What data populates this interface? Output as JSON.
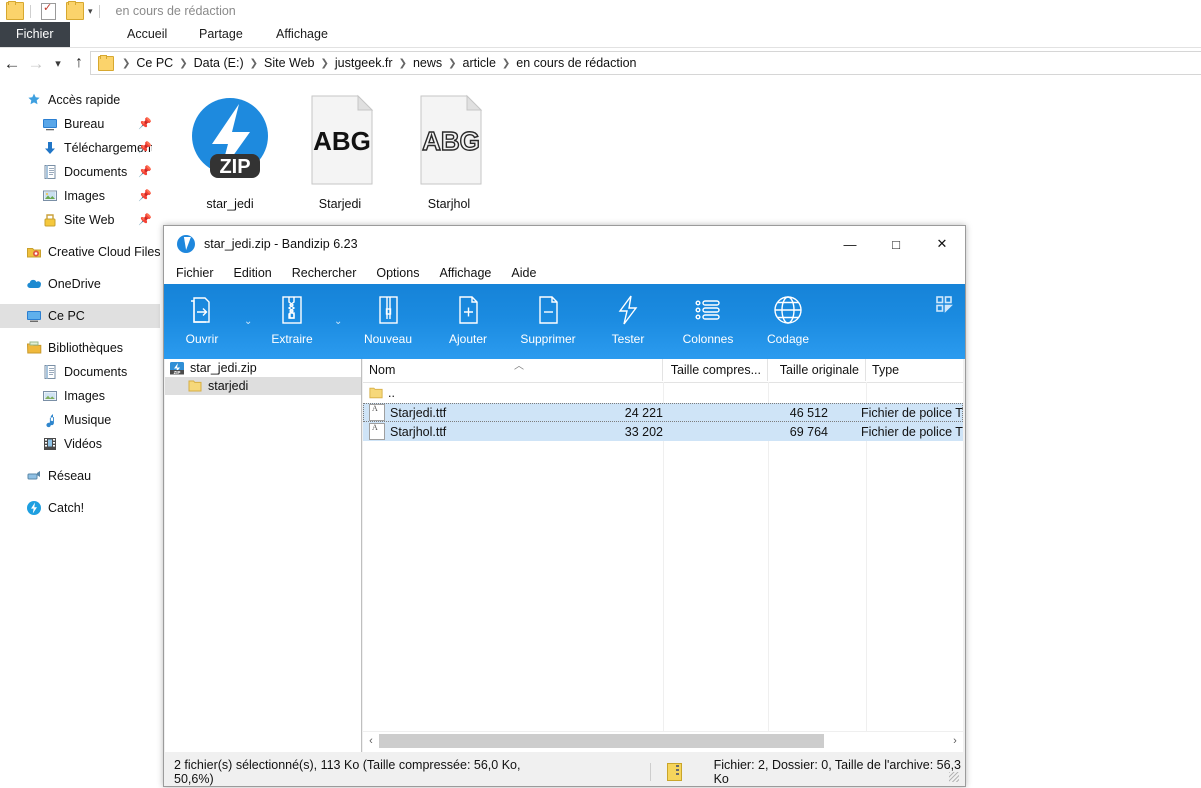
{
  "explorer": {
    "quick_access_toolbar": {
      "title": "en cours de rédaction",
      "icons": [
        "folder-icon",
        "properties-icon",
        "new-folder-icon",
        "customize-caret-icon"
      ]
    },
    "ribbon_tabs": [
      {
        "label": "Fichier",
        "active": true
      },
      {
        "label": "Accueil",
        "active": false
      },
      {
        "label": "Partage",
        "active": false
      },
      {
        "label": "Affichage",
        "active": false
      }
    ],
    "navigation": {
      "back_icon": "back-arrow-icon",
      "forward_icon": "forward-arrow-icon",
      "recent_icon": "chevron-down-icon",
      "up_icon": "up-arrow-icon"
    },
    "breadcrumb": [
      "Ce PC",
      "Data (E:)",
      "Site Web",
      "justgeek.fr",
      "news",
      "article",
      "en cours de rédaction"
    ],
    "sidebar": [
      {
        "label": "Accès rapide",
        "icon": "star-icon",
        "indent": 0,
        "pinned": false,
        "selected": false
      },
      {
        "label": "Bureau",
        "icon": "desktop-icon",
        "indent": 1,
        "pinned": true,
        "selected": false
      },
      {
        "label": "Téléchargements",
        "icon": "download-icon",
        "indent": 1,
        "pinned": true,
        "selected": false
      },
      {
        "label": "Documents",
        "icon": "documents-icon",
        "indent": 1,
        "pinned": true,
        "selected": false
      },
      {
        "label": "Images",
        "icon": "pictures-icon",
        "indent": 1,
        "pinned": true,
        "selected": false
      },
      {
        "label": "Site Web",
        "icon": "lock-folder-icon",
        "indent": 1,
        "pinned": true,
        "selected": false
      },
      {
        "label": "Creative Cloud Files",
        "icon": "creative-cloud-icon",
        "indent": 0,
        "pinned": false,
        "selected": false
      },
      {
        "label": "OneDrive",
        "icon": "cloud-icon",
        "indent": 0,
        "pinned": false,
        "selected": false
      },
      {
        "label": "Ce PC",
        "icon": "this-pc-icon",
        "indent": 0,
        "pinned": false,
        "selected": true
      },
      {
        "label": "Bibliothèques",
        "icon": "libraries-icon",
        "indent": 0,
        "pinned": false,
        "selected": false
      },
      {
        "label": "Documents",
        "icon": "documents-icon",
        "indent": 1,
        "pinned": false,
        "selected": false
      },
      {
        "label": "Images",
        "icon": "pictures-icon",
        "indent": 1,
        "pinned": false,
        "selected": false
      },
      {
        "label": "Musique",
        "icon": "music-icon",
        "indent": 1,
        "pinned": false,
        "selected": false
      },
      {
        "label": "Vidéos",
        "icon": "video-icon",
        "indent": 1,
        "pinned": false,
        "selected": false
      },
      {
        "label": "Réseau",
        "icon": "network-icon",
        "indent": 0,
        "pinned": false,
        "selected": false
      },
      {
        "label": "Catch!",
        "icon": "catch-icon",
        "indent": 0,
        "pinned": false,
        "selected": false
      }
    ],
    "files": [
      {
        "name": "star_jedi",
        "icon": "zip-archive-icon",
        "badge": "ZIP"
      },
      {
        "name": "Starjedi",
        "icon": "font-file-icon",
        "badge": "ABG"
      },
      {
        "name": "Starjhol",
        "icon": "font-file-outline-icon",
        "badge": "ABG"
      }
    ]
  },
  "bandizip": {
    "title": "star_jedi.zip - Bandizip 6.23",
    "window_controls": {
      "minimize": "—",
      "maximize": "□",
      "close": "✕"
    },
    "menus": [
      "Fichier",
      "Edition",
      "Rechercher",
      "Options",
      "Affichage",
      "Aide"
    ],
    "toolbar": [
      {
        "label": "Ouvrir",
        "icon": "open-archive-icon",
        "has_caret": true
      },
      {
        "label": "Extraire",
        "icon": "extract-icon",
        "has_caret": true
      },
      {
        "label": "Nouveau",
        "icon": "new-archive-icon",
        "has_caret": false
      },
      {
        "label": "Ajouter",
        "icon": "add-file-icon",
        "has_caret": false
      },
      {
        "label": "Supprimer",
        "icon": "delete-file-icon",
        "has_caret": false
      },
      {
        "label": "Tester",
        "icon": "test-archive-icon",
        "has_caret": false
      },
      {
        "label": "Colonnes",
        "icon": "columns-icon",
        "has_caret": false
      },
      {
        "label": "Codage",
        "icon": "encoding-globe-icon",
        "has_caret": false
      }
    ],
    "toolbar_grid_icon": "layout-grid-icon",
    "tree": [
      {
        "label": "star_jedi.zip",
        "icon": "zip-node-icon",
        "indent": 0,
        "selected": false
      },
      {
        "label": "starjedi",
        "icon": "folder-icon",
        "indent": 1,
        "selected": true
      }
    ],
    "columns": [
      {
        "label": "Nom",
        "align": "left"
      },
      {
        "label": "Taille compres...",
        "align": "left"
      },
      {
        "label": "Taille originale",
        "align": "left"
      },
      {
        "label": "Type",
        "align": "left"
      }
    ],
    "sort_indicator": "ascending-chevron-icon",
    "rows": [
      {
        "name": "..",
        "icon": "parent-folder-icon",
        "compressed": "",
        "original": "",
        "type": "",
        "selected": false
      },
      {
        "name": "Starjedi.ttf",
        "icon": "ttf-file-icon",
        "compressed": "24 221",
        "original": "46 512",
        "type": "Fichier de police T",
        "selected": true
      },
      {
        "name": "Starjhol.ttf",
        "icon": "ttf-file-icon",
        "compressed": "33 202",
        "original": "69 764",
        "type": "Fichier de police T",
        "selected": true
      }
    ],
    "hscrollbar": {
      "left_arrow": "‹",
      "right_arrow": "›"
    },
    "status": {
      "left": "2 fichier(s) sélectionné(s), 113 Ko (Taille compressée: 56,0 Ko, 50,6%)",
      "icon": "archive-small-icon",
      "right": "Fichier: 2, Dossier: 0, Taille de l'archive: 56,3 Ko"
    }
  },
  "colors": {
    "toolbar_blue": "#1b8be0",
    "selection_blue": "#cfe4f7",
    "sidebar_selection": "#e0e0e0",
    "file_tab_dark": "#3b4148",
    "zip_icon_blue": "#1e87dd"
  }
}
